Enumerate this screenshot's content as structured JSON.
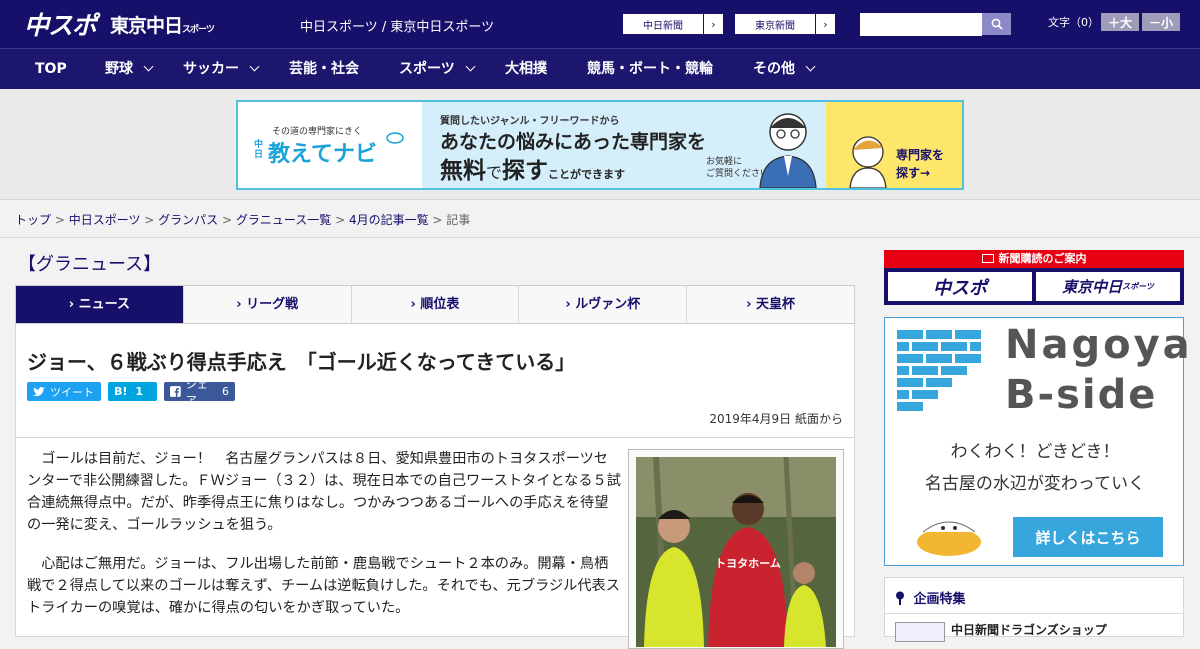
{
  "header": {
    "logo_chuspo": "中スポ",
    "logo_tokyo": "東京中日",
    "logo_tokyo_sub": "スポーツ",
    "site_title": "中日スポーツ / 東京中日スポーツ",
    "btn_chunichi": "中日新聞",
    "btn_tokyo": "東京新聞",
    "btn_arrow": "›",
    "search_placeholder": "",
    "font_label": "文字（0）",
    "font_bigger": "＋大",
    "font_smaller": "－小"
  },
  "nav": [
    {
      "label": "TOP"
    },
    {
      "label": "野球"
    },
    {
      "label": "サッカー"
    },
    {
      "label": "芸能・社会"
    },
    {
      "label": "スポーツ"
    },
    {
      "label": "大相撲"
    },
    {
      "label": "競馬・ボート・競輪"
    },
    {
      "label": "その他"
    }
  ],
  "ad": {
    "brand_small": "その道の専門家にきく",
    "brand_prefix": "中日",
    "brand": "教えてナビ",
    "line1": "質問したいジャンル・フリーワードから",
    "line2": "あなたの悩みにあった専門家を",
    "line3a": "無料",
    "line3b": "で",
    "line3c": "探す",
    "line3d": "ことができます",
    "note": "お気軽に\nご質問ください!",
    "cta1": "専門家を",
    "cta2": "探す→"
  },
  "breadcrumb": {
    "items": [
      "トップ",
      "中日スポーツ",
      "グランパス",
      "グラニュース一覧",
      "4月の記事一覧"
    ],
    "current": "記事",
    "sep": " > "
  },
  "section_title": "【グラニュース】",
  "tabs": [
    {
      "label": "› ニュース",
      "active": true
    },
    {
      "label": "› リーグ戦",
      "active": false
    },
    {
      "label": "› 順位表",
      "active": false
    },
    {
      "label": "› ルヴァン杯",
      "active": false
    },
    {
      "label": "› 天皇杯",
      "active": false
    }
  ],
  "article": {
    "headline": "ジョー、６戦ぶり得点手応え　「ゴール近くなってきている」",
    "tweet": "ツイート",
    "hatena_label": "B!",
    "hatena_count": "1",
    "facebook": "シェア",
    "facebook_count": "6",
    "date": "2019年4月9日 紙面から",
    "para1": "　ゴールは目前だ、ジョー！　名古屋グランパスは８日、愛知県豊田市のトヨタスポーツセンターで非公開練習した。ＦＷジョー（３２）は、現在日本での自己ワーストタイとなる５試合連続無得点中。だが、昨季得点王に焦りはなし。つかみつつあるゴールへの手応えを待望の一発に変え、ゴールラッシュを狙う。",
    "para2": "　心配はご無用だ。ジョーは、フル出場した前節・鹿島戦でシュート２本のみ。開幕・鳥栖戦で２得点して以来のゴールは奪えず、チームは逆転負けした。それでも、元ブラジル代表ストライカーの嗅覚は、確かに得点の匂いをかぎ取っていた。",
    "photo_shirt": "トヨタホーム"
  },
  "sidebar": {
    "subscribe_caption": "新聞購読のご案内",
    "sub_chuspo": "中スポ",
    "sub_tokyo": "東京中日",
    "sub_tokyo_small": "スポーツ",
    "bside_title1": "Nagoya",
    "bside_title2": "B-side",
    "bside_line1": "わくわく！どきどき！",
    "bside_line2": "名古屋の水辺が変わっていく",
    "bside_button": "詳しくはこちら",
    "feature_heading": "企画特集",
    "feature_item": "中日新聞ドラゴンズショップ"
  },
  "colors": {
    "brand_navy": "#17106a",
    "accent_blue": "#37a6dc",
    "twitter": "#1da1f2",
    "hatena": "#00a4de",
    "facebook": "#3b5998"
  }
}
